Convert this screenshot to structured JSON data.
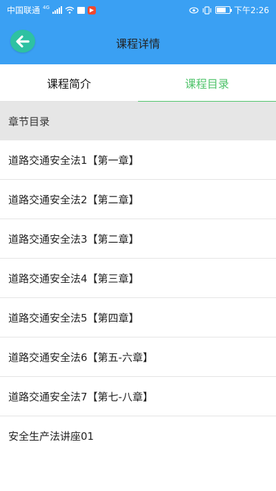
{
  "status_bar": {
    "carrier": "中国联通",
    "network": "4G",
    "time": "下午2:26",
    "battery_level": 0.7,
    "icons": [
      "signal-icon",
      "wifi-icon",
      "notification-icon",
      "app-notification-icon",
      "eye-icon",
      "vibrate-icon",
      "battery-icon"
    ]
  },
  "header": {
    "title": "课程详情",
    "back_icon": "arrow-left-icon",
    "back_button_color": "#2ec1a2",
    "background_color": "#3aa0f3"
  },
  "tabs": [
    {
      "label": "课程简介",
      "active": false
    },
    {
      "label": "课程目录",
      "active": true
    }
  ],
  "accent_color": "#4fc36a",
  "catalog": {
    "section_title": "章节目录",
    "items": [
      "道路交通安全法1【第一章】",
      "道路交通安全法2【第二章】",
      "道路交通安全法3【第二章】",
      "道路交通安全法4【第三章】",
      "道路交通安全法5【第四章】",
      "道路交通安全法6【第五-六章】",
      "道路交通安全法7【第七-八章】",
      "安全生产法讲座01"
    ]
  }
}
